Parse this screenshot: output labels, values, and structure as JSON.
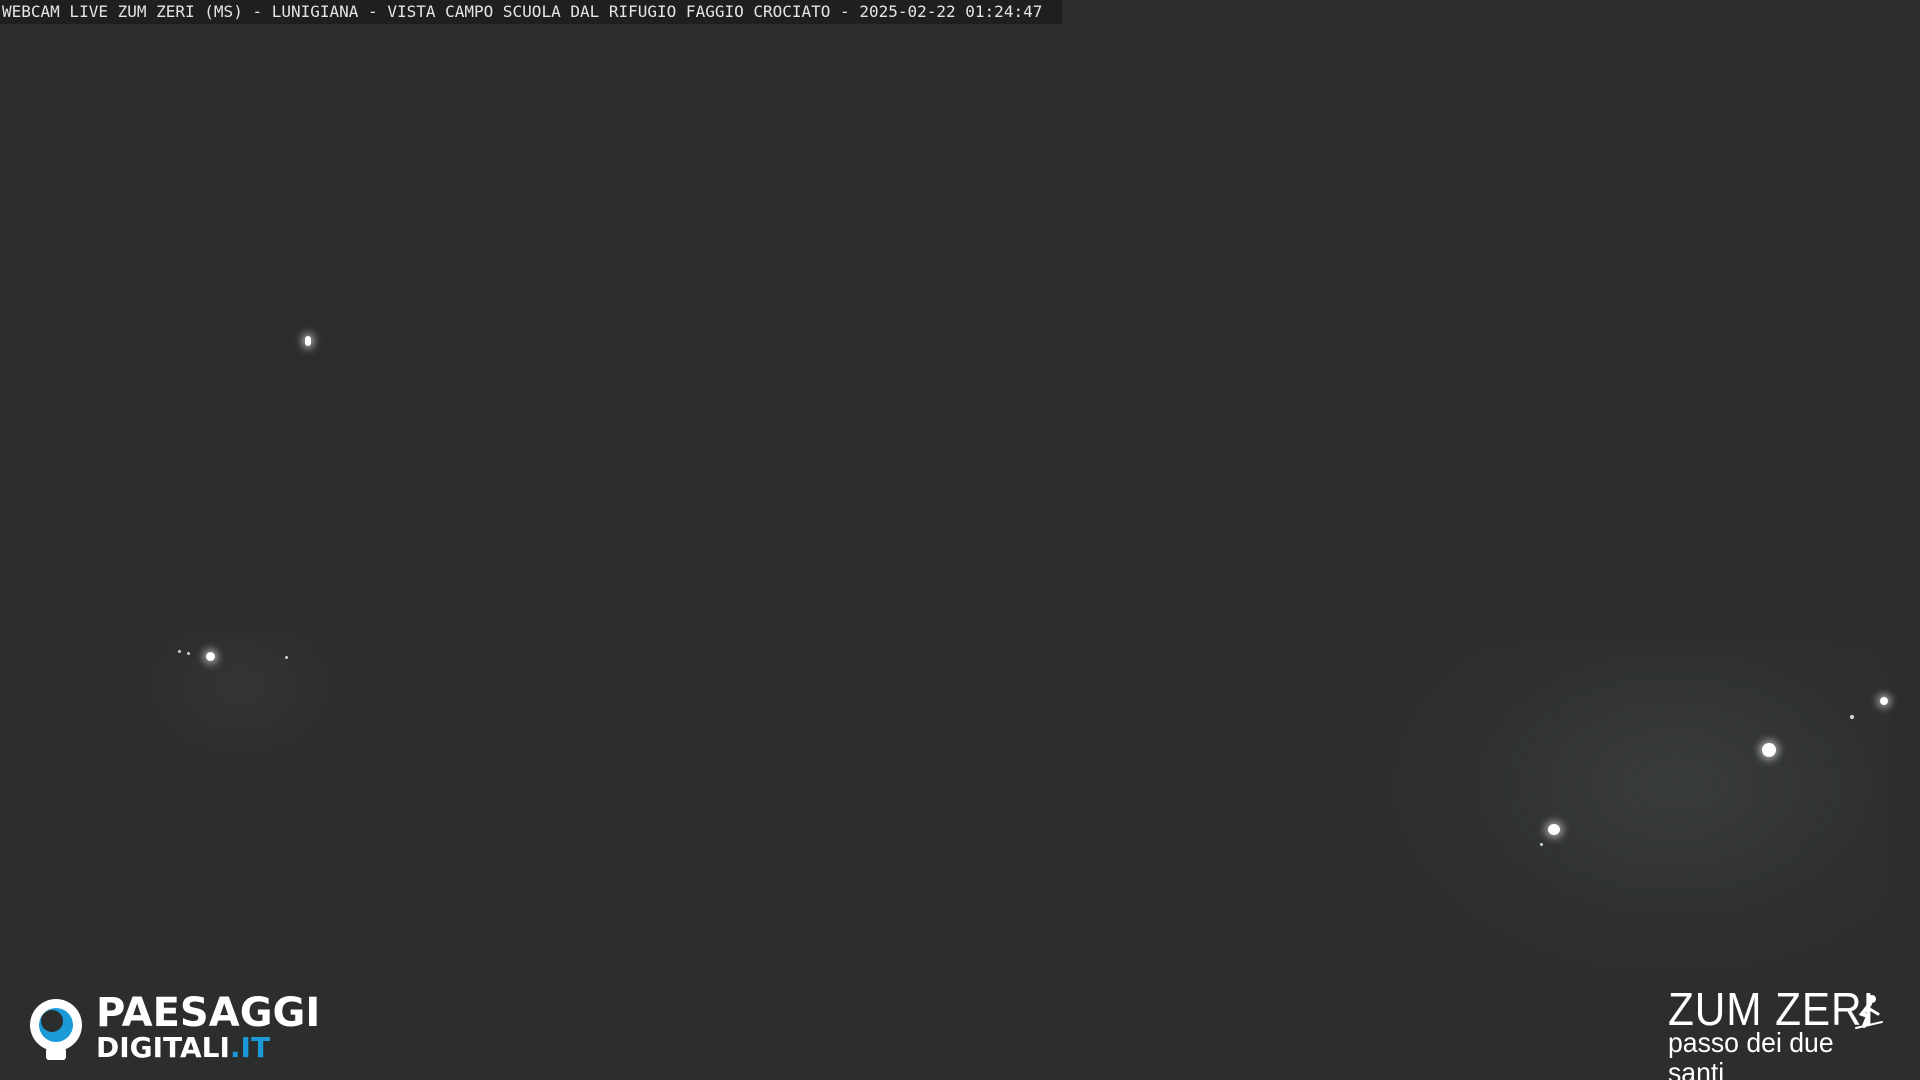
{
  "overlay": {
    "caption": "WEBCAM LIVE ZUM ZERI (MS) - LUNIGIANA - VISTA CAMPO SCUOLA DAL RIFUGIO FAGGIO CROCIATO - 2025-02-22 01:24:47"
  },
  "logos": {
    "left": {
      "line1": "PAESAGGI",
      "line2_main": "DIGITALI",
      "line2_tld": ".IT",
      "icon": "eye-icon",
      "accent_color": "#1a9ad6"
    },
    "right": {
      "title": "ZUM ZERI",
      "subtitle": "passo dei due santi",
      "icon": "skier-icon"
    }
  },
  "colors": {
    "background": "#2c2e2d",
    "text": "#ffffff"
  }
}
